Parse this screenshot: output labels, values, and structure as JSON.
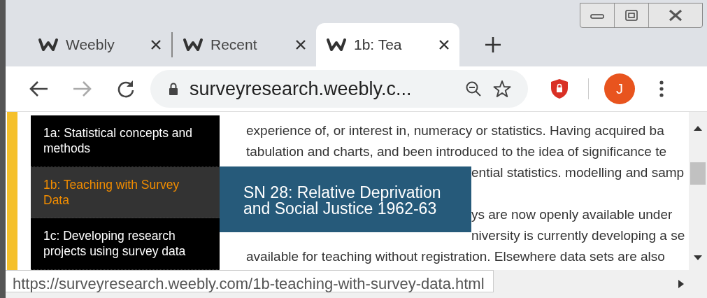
{
  "tabs": [
    {
      "title": "Weebly",
      "selected": false
    },
    {
      "title": "Recent",
      "selected": false
    },
    {
      "title": "1b: Tea",
      "selected": true
    }
  ],
  "address": {
    "url": "surveyresearch.weebly.c..."
  },
  "profile": {
    "initial": "J"
  },
  "sidebar": {
    "items": [
      {
        "label": "1a: Statistical concepts and methods",
        "selected": false
      },
      {
        "label": "1b: Teaching with Survey Data",
        "selected": true
      },
      {
        "label": "1c: Developing research projects using survey data",
        "selected": false
      }
    ]
  },
  "article": {
    "lines": [
      {
        "kind": "full",
        "text": "experience of, or interest in, numeracy or statistics.  Having acquired ba"
      },
      {
        "kind": "full",
        "text": "tabulation and charts, and been introduced to the idea of significance te"
      },
      {
        "kind": "behind",
        "text": "ential statistics. modelling and samp"
      },
      {
        "kind": "gap"
      },
      {
        "kind": "behind",
        "text": "ys are now openly available under"
      },
      {
        "kind": "behind",
        "text": "niversity is currently developing a se"
      },
      {
        "kind": "full",
        "text": "available for teaching without registration. Elsewhere data sets are also"
      }
    ]
  },
  "tooltip": {
    "text": "SN 28: Relative Deprivation and Social Justice 1962-63"
  },
  "status_bar": {
    "url": "https://surveyresearch.weebly.com/1b-teaching-with-survey-data.html"
  }
}
